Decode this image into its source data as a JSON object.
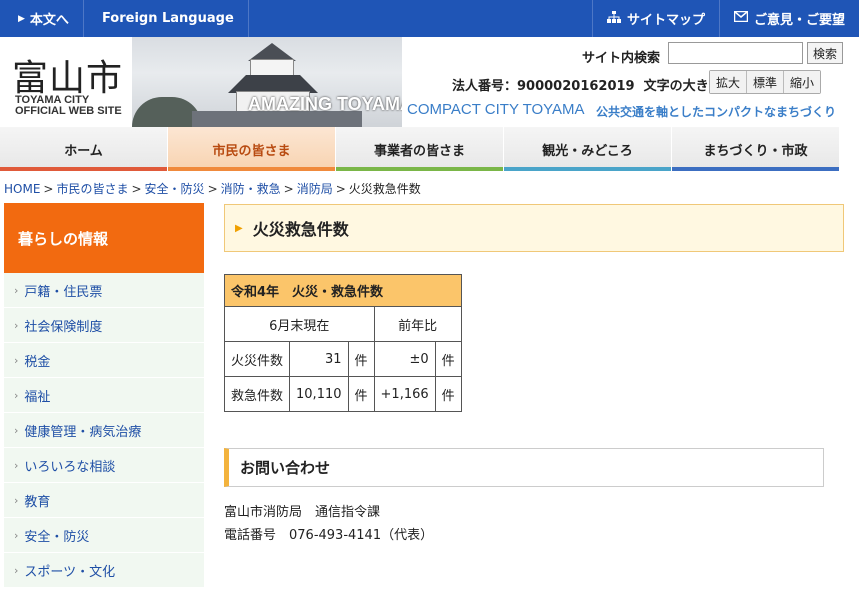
{
  "topbar": {
    "skip_label": "本文へ",
    "lang_label": "Foreign Language",
    "sitemap_label": "サイトマップ",
    "opinion_label": "ご意見・ご要望"
  },
  "header": {
    "logo_kanji": "富山市",
    "logo_en_line1": "TOYAMA CITY",
    "logo_en_line2": "OFFICIAL WEB SITE",
    "amazing_text": "AMAZING TOYAMA",
    "compact_text": "COMPACT CITY TOYAMA",
    "compact_jp": "公共交通を軸としたコンパクトなまちづくり",
    "search_label": "サイト内検索",
    "search_value": "",
    "search_button": "検索",
    "corp_number": "法人番号：9000020162019",
    "fontsize_label": "文字の大きさ",
    "fontsize_options": [
      "拡大",
      "標準",
      "縮小"
    ]
  },
  "gnav": [
    {
      "label": "ホーム"
    },
    {
      "label": "市民の皆さま"
    },
    {
      "label": "事業者の皆さま"
    },
    {
      "label": "観光・みどころ"
    },
    {
      "label": "まちづくり・市政"
    }
  ],
  "breadcrumb": [
    "HOME",
    "市民の皆さま",
    "安全・防災",
    "消防・救急",
    "消防局",
    "火災救急件数"
  ],
  "sidebar": {
    "heading": "暮らしの情報",
    "items": [
      "戸籍・住民票",
      "社会保険制度",
      "税金",
      "福祉",
      "健康管理・病気治療",
      "いろいろな相談",
      "教育",
      "安全・防災",
      "スポーツ・文化"
    ]
  },
  "main": {
    "title": "火災救急件数",
    "table": {
      "caption": "令和4年　火災・救急件数",
      "col1_header": "6月末現在",
      "col2_header": "前年比",
      "rows": [
        {
          "label": "火災件数",
          "value": "31",
          "unit": "件",
          "diff": "±0",
          "diff_unit": "件"
        },
        {
          "label": "救急件数",
          "value": "10,110",
          "unit": "件",
          "diff": "+1,166",
          "diff_unit": "件"
        }
      ]
    },
    "inquiry": {
      "title": "お問い合わせ",
      "dept": "富山市消防局　通信指令課",
      "phone": "電話番号　076-493-4141（代表）"
    }
  },
  "colors": {
    "topbar": "#1f55b6",
    "sidebar_head": "#f26a10",
    "table_caption": "#fbc56a",
    "link": "#1f4fa6"
  }
}
